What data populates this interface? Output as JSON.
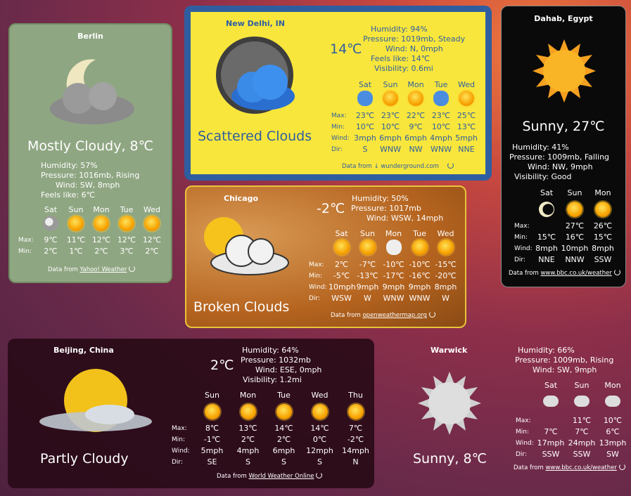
{
  "berlin": {
    "city": "Berlin",
    "condition": "Mostly Cloudy, 8℃",
    "details": [
      "Humidity: 57%",
      "Pressure: 1016mb, Rising",
      "Wind: SW, 8mph",
      "Feels like: 6℃"
    ],
    "days": [
      "Sat",
      "Sun",
      "Mon",
      "Tue",
      "Wed"
    ],
    "icons": [
      "moon-cloud-icon",
      "sun-cloud-icon",
      "sun-icon",
      "sun-cloud-icon",
      "sun-cloud-icon"
    ],
    "max_label": "Max:",
    "min_label": "Min:",
    "max": [
      "9℃",
      "11℃",
      "12℃",
      "12℃",
      "12℃"
    ],
    "min": [
      "2℃",
      "1℃",
      "2℃",
      "3℃",
      "2℃"
    ],
    "source_prefix": "Data from",
    "source": "Yahoo! Weather"
  },
  "delhi": {
    "city": "New Delhi, IN",
    "temp": "14℃",
    "condition": "Scattered Clouds",
    "details": [
      "Humidity: 94%",
      "Pressure: 1019mb, Steady",
      "Wind: N, 0mph",
      "Feels like: 14℃",
      "Visibility: 0.6mi"
    ],
    "days": [
      "Sat",
      "Sun",
      "Mon",
      "Tue",
      "Wed"
    ],
    "icons": [
      "rain-cloud-icon",
      "sun-cloud-icon",
      "sun-icon",
      "rain-cloud-icon",
      "sun-cloud-icon"
    ],
    "labels": [
      "Max:",
      "Min:",
      "Wind:",
      "Dir:"
    ],
    "max": [
      "23℃",
      "23℃",
      "22℃",
      "23℃",
      "25℃"
    ],
    "min": [
      "10℃",
      "10℃",
      "9℃",
      "10℃",
      "13℃"
    ],
    "wind": [
      "3mph",
      "6mph",
      "6mph",
      "4mph",
      "5mph"
    ],
    "dir": [
      "S",
      "WNW",
      "NW",
      "WNW",
      "NNE"
    ],
    "source_prefix": "Data from",
    "source": "wunderground.com"
  },
  "dahab": {
    "city": "Dahab, Egypt",
    "condition": "Sunny, 27℃",
    "details": [
      "Humidity: 41%",
      "Pressure: 1009mb, Falling",
      "Wind: NW, 9mph",
      "Visibility: Good"
    ],
    "days": [
      "Sat",
      "Sun",
      "Mon"
    ],
    "icons": [
      "moon-icon",
      "sun-icon",
      "sun-icon"
    ],
    "labels": [
      "Max:",
      "Min:",
      "Wind:",
      "Dir:"
    ],
    "max": [
      "",
      "27℃",
      "26℃"
    ],
    "min": [
      "15℃",
      "16℃",
      "15℃"
    ],
    "wind": [
      "8mph",
      "10mph",
      "8mph"
    ],
    "dir": [
      "NNE",
      "NNW",
      "SSW"
    ],
    "source_prefix": "Data from",
    "source": "www.bbc.co.uk/weather"
  },
  "chicago": {
    "city": "Chicago",
    "temp": "-2℃",
    "condition": "Broken Clouds",
    "details": [
      "Humidity: 50%",
      "Pressure: 1017mb",
      "Wind: WSW, 14mph"
    ],
    "days": [
      "Sat",
      "Sun",
      "Mon",
      "Tue",
      "Wed"
    ],
    "icons": [
      "sun-cloud-icon",
      "sun-cloud-icon",
      "snow-cloud-icon",
      "sun-icon",
      "sun-icon"
    ],
    "labels": [
      "Max:",
      "Min:",
      "Wind:",
      "Dir:"
    ],
    "max": [
      "2℃",
      "-7℃",
      "-10℃",
      "-10℃",
      "-15℃"
    ],
    "min": [
      "-5℃",
      "-13℃",
      "-17℃",
      "-16℃",
      "-20℃"
    ],
    "wind": [
      "10mph",
      "9mph",
      "9mph",
      "9mph",
      "8mph"
    ],
    "dir": [
      "WSW",
      "W",
      "WNW",
      "WNW",
      "W"
    ],
    "source_prefix": "Data from",
    "source": "openweathermap.org"
  },
  "beijing": {
    "city": "Beijing, China",
    "temp": "2℃",
    "condition": "Partly Cloudy",
    "details": [
      "Humidity: 64%",
      "Pressure: 1032mb",
      "Wind: ESE, 0mph",
      "Visibility: 1.2mi"
    ],
    "days": [
      "Sun",
      "Mon",
      "Tue",
      "Wed",
      "Thu"
    ],
    "icons": [
      "sun-icon",
      "sun-icon",
      "sun-icon",
      "sun-icon",
      "sun-cloud-icon"
    ],
    "labels": [
      "Max:",
      "Min:",
      "Wind:",
      "Dir:"
    ],
    "max": [
      "8℃",
      "13℃",
      "14℃",
      "14℃",
      "7℃"
    ],
    "min": [
      "-1℃",
      "2℃",
      "2℃",
      "0℃",
      "-2℃"
    ],
    "wind": [
      "5mph",
      "4mph",
      "6mph",
      "12mph",
      "14mph"
    ],
    "dir": [
      "SE",
      "S",
      "S",
      "S",
      "N"
    ],
    "source_prefix": "Data from",
    "source": "World Weather Online"
  },
  "warwick": {
    "city": "Warwick",
    "condition": "Sunny, 8℃",
    "details": [
      "Humidity: 66%",
      "Pressure: 1009mb, Rising",
      "Wind: SW, 9mph"
    ],
    "days": [
      "Sat",
      "Sun",
      "Mon"
    ],
    "icons": [
      "cloud-icon",
      "cloud-icon",
      "snow-cloud-icon"
    ],
    "labels": [
      "Max:",
      "Min:",
      "Wind:",
      "Dir:"
    ],
    "max": [
      "",
      "11℃",
      "10℃"
    ],
    "min": [
      "7℃",
      "7℃",
      "6℃"
    ],
    "wind": [
      "17mph",
      "24mph",
      "13mph"
    ],
    "dir": [
      "SSW",
      "SSW",
      "SW"
    ],
    "source_prefix": "Data from",
    "source": "www.bbc.co.uk/weather"
  }
}
